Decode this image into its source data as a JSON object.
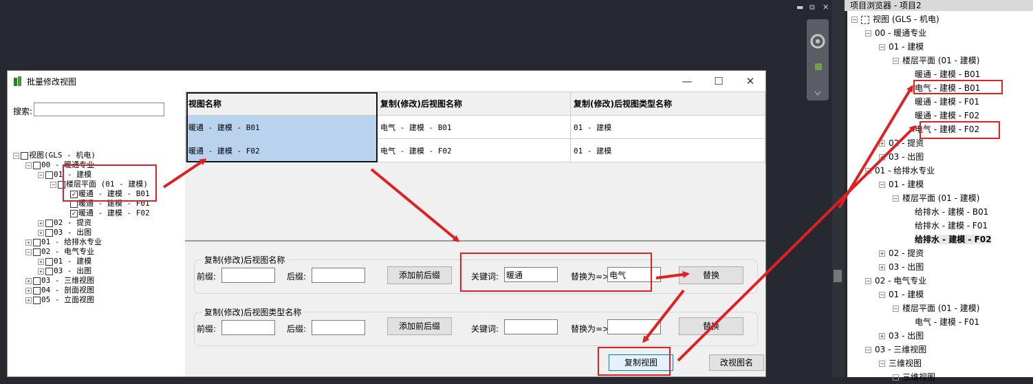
{
  "app_controls": {
    "minimize": "▬",
    "restore": "⧉",
    "close": "✕"
  },
  "dialog": {
    "title": "批量修改视图",
    "search_label": "搜索:",
    "search_value": "",
    "tree": [
      {
        "label": "视图(GLS - 机电)",
        "level": 0,
        "expander": "−",
        "checked": false
      },
      {
        "label": "00 - 暖通专业",
        "level": 1,
        "expander": "−",
        "checked": false
      },
      {
        "label": "01 - 建模",
        "level": 2,
        "expander": "−",
        "checked": false
      },
      {
        "label": "楼层平面 (01 - 建模)",
        "level": 3,
        "expander": "−",
        "checked": false
      },
      {
        "label": "暖通 - 建模 - B01",
        "level": 4,
        "expander": "",
        "checked": true
      },
      {
        "label": "暖通 - 建模 - F01",
        "level": 4,
        "expander": "",
        "checked": false
      },
      {
        "label": "暖通 - 建模 - F02",
        "level": 4,
        "expander": "",
        "checked": true
      },
      {
        "label": "02 - 提资",
        "level": 2,
        "expander": "+",
        "checked": false
      },
      {
        "label": "03 - 出图",
        "level": 2,
        "expander": "+",
        "checked": false
      },
      {
        "label": "01 - 给排水专业",
        "level": 1,
        "expander": "+",
        "checked": false
      },
      {
        "label": "02 - 电气专业",
        "level": 1,
        "expander": "−",
        "checked": false
      },
      {
        "label": "01 - 建模",
        "level": 2,
        "expander": "+",
        "checked": false
      },
      {
        "label": "03 - 出图",
        "level": 2,
        "expander": "+",
        "checked": false
      },
      {
        "label": "03 - 三维视图",
        "level": 1,
        "expander": "+",
        "checked": false
      },
      {
        "label": "04 - 剖面视图",
        "level": 1,
        "expander": "+",
        "checked": false
      },
      {
        "label": "05 - 立面视图",
        "level": 1,
        "expander": "+",
        "checked": false
      }
    ],
    "grid": {
      "headers": [
        "视图名称",
        "复制(修改)后视图名称",
        "复制(修改)后视图类型名称"
      ],
      "rows": [
        [
          "暖通 - 建模 - B01",
          "电气 - 建模 - B01",
          "01 - 建模"
        ],
        [
          "暖通 - 建模 - F02",
          "电气 - 建模 - F02",
          "01 - 建模"
        ]
      ]
    },
    "name_group": {
      "legend": "复制(修改)后视图名称",
      "prefix_label": "前缀:",
      "prefix_value": "",
      "suffix_label": "后缀:",
      "suffix_value": "",
      "add_button": "添加前后缀",
      "keyword_label": "关键词:",
      "keyword_value": "暖通",
      "replace_label": "替换为=>",
      "replace_value": "电气",
      "replace_button": "替换"
    },
    "type_group": {
      "legend": "复制(修改)后视图类型名称",
      "prefix_label": "前缀:",
      "prefix_value": "",
      "suffix_label": "后缀:",
      "suffix_value": "",
      "add_button": "添加前后缀",
      "keyword_label": "关键词:",
      "keyword_value": "",
      "replace_label": "替换为=>",
      "replace_value": "",
      "replace_button": "替换"
    },
    "copy_button": "复制视图",
    "rename_button": "改视图名"
  },
  "browser": {
    "title": "项目浏览器 - 项目2",
    "items": [
      {
        "label": "视图 (GLS - 机电)",
        "level": 0,
        "expander": "−"
      },
      {
        "label": "00 - 暖通专业",
        "level": 1,
        "expander": "−"
      },
      {
        "label": "01 - 建模",
        "level": 2,
        "expander": "−"
      },
      {
        "label": "楼层平面 (01 - 建模)",
        "level": 3,
        "expander": "−"
      },
      {
        "label": "暖通 - 建模 - B01",
        "level": 4,
        "expander": ""
      },
      {
        "label": "电气 - 建模 - B01",
        "level": 4,
        "expander": ""
      },
      {
        "label": "暖通 - 建模 - F01",
        "level": 4,
        "expander": ""
      },
      {
        "label": "暖通 - 建模 - F02",
        "level": 4,
        "expander": ""
      },
      {
        "label": "电气 - 建模 - F02",
        "level": 4,
        "expander": ""
      },
      {
        "label": "02 - 提资",
        "level": 2,
        "expander": "+"
      },
      {
        "label": "03 - 出图",
        "level": 2,
        "expander": "+"
      },
      {
        "label": "01 - 给排水专业",
        "level": 1,
        "expander": "−"
      },
      {
        "label": "01 - 建模",
        "level": 2,
        "expander": "−"
      },
      {
        "label": "楼层平面 (01 - 建模)",
        "level": 3,
        "expander": "−"
      },
      {
        "label": "给排水 - 建模 - B01",
        "level": 4,
        "expander": ""
      },
      {
        "label": "给排水 - 建模 - F01",
        "level": 4,
        "expander": ""
      },
      {
        "label": "给排水 - 建模 - F02",
        "level": 4,
        "expander": "",
        "bold": true
      },
      {
        "label": "02 - 提资",
        "level": 2,
        "expander": "+"
      },
      {
        "label": "03 - 出图",
        "level": 2,
        "expander": "+"
      },
      {
        "label": "02 - 电气专业",
        "level": 1,
        "expander": "−"
      },
      {
        "label": "01 - 建模",
        "level": 2,
        "expander": "−"
      },
      {
        "label": "楼层平面 (01 - 建模)",
        "level": 3,
        "expander": "−"
      },
      {
        "label": "电气 - 建模 - F01",
        "level": 4,
        "expander": ""
      },
      {
        "label": "03 - 出图",
        "level": 2,
        "expander": "+"
      },
      {
        "label": "03 - 三维视图",
        "level": 1,
        "expander": "−"
      },
      {
        "label": "三维视图",
        "level": 2,
        "expander": "−"
      },
      {
        "label": "三维视图",
        "level": 3,
        "expander": "−"
      }
    ]
  }
}
